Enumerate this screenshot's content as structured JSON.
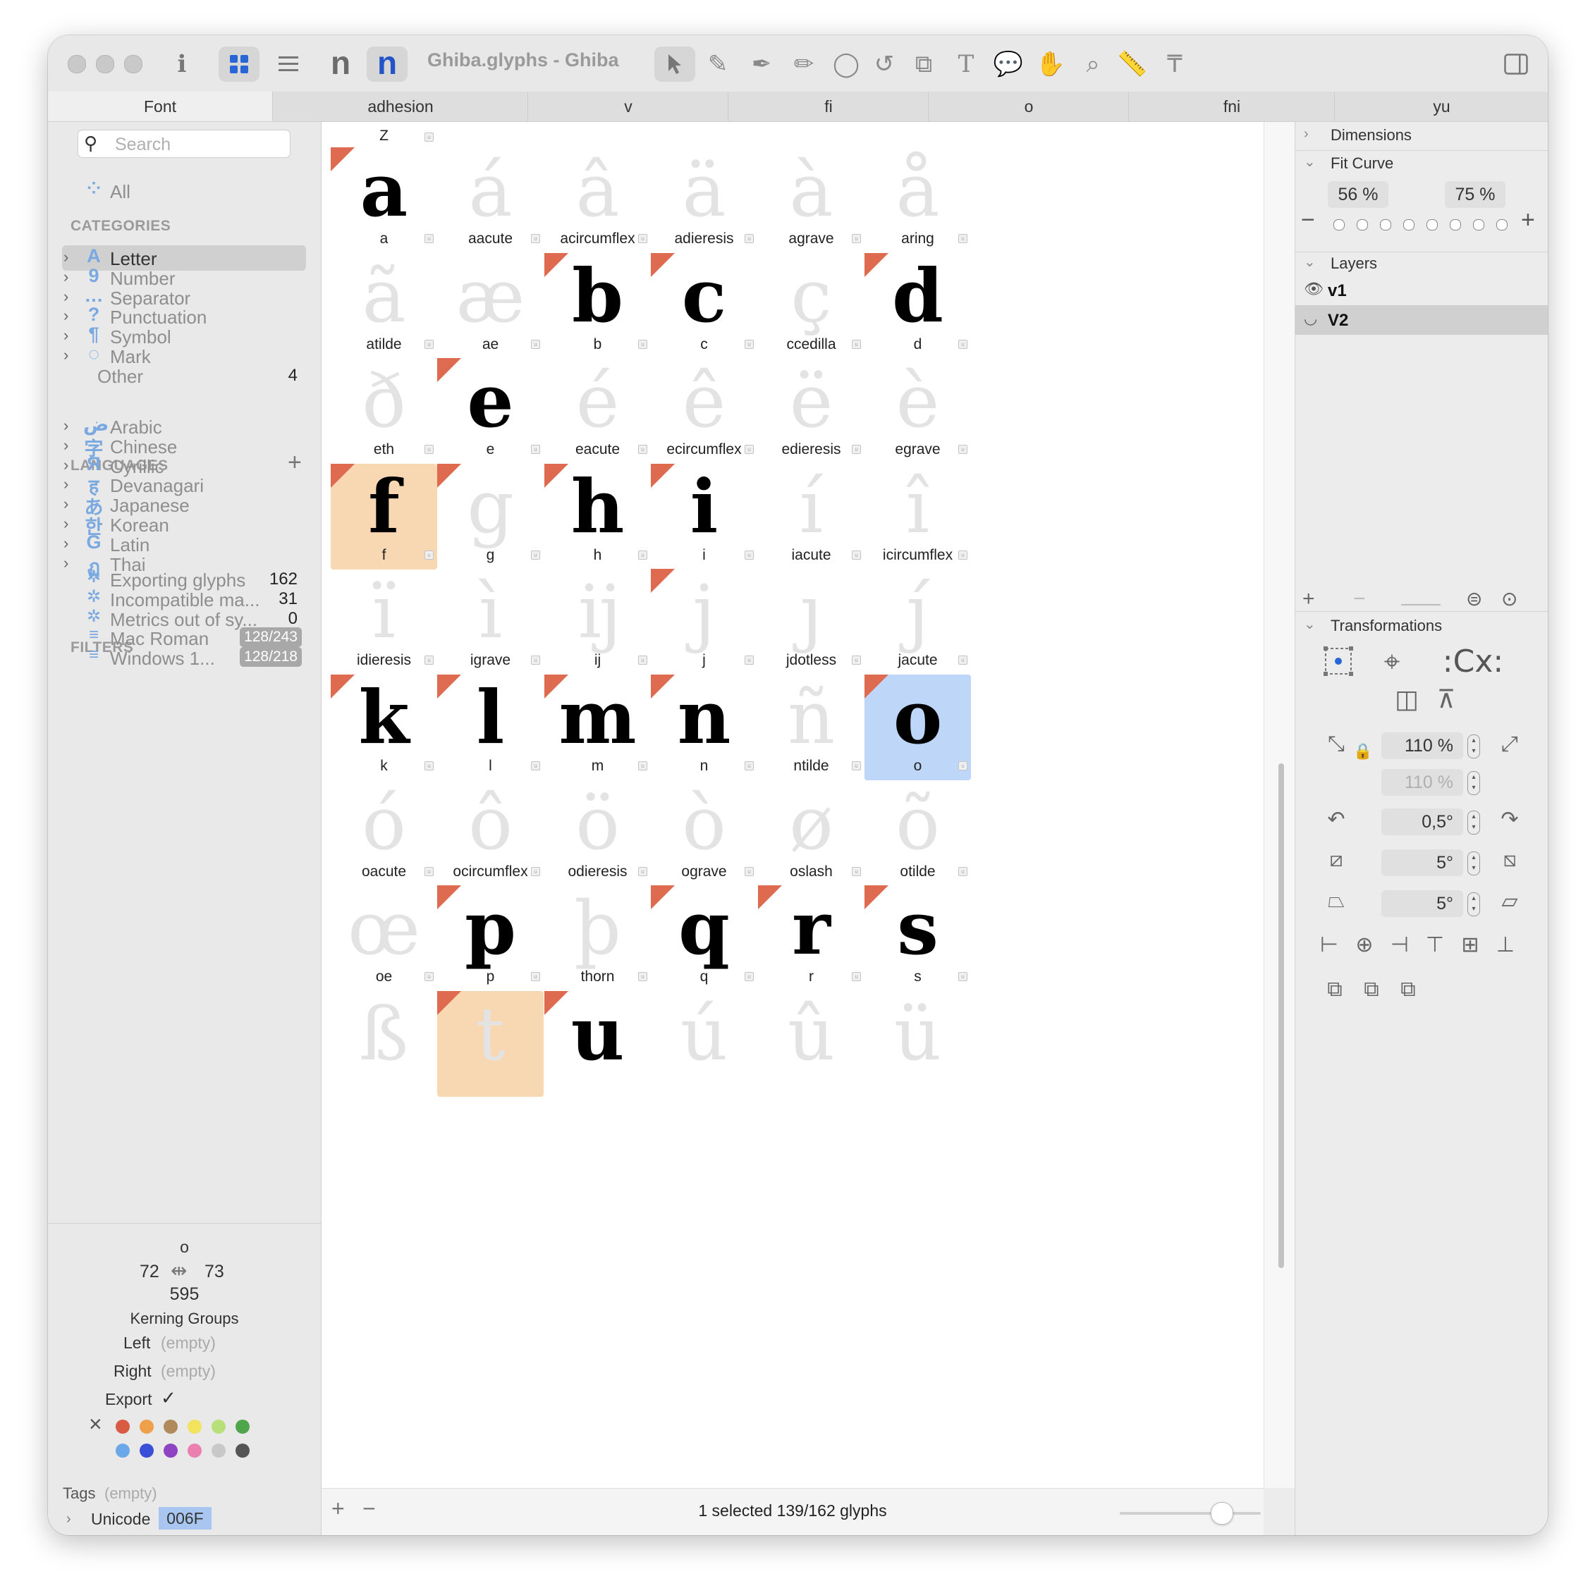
{
  "toolbar": {
    "doc_title": "Ghiba.glyphs - Ghiba",
    "info_icon": "info-icon",
    "view_grid_icon": "grid-view-icon",
    "view_list_icon": "list-view-icon"
  },
  "tabs": [
    "Font",
    "adhesion",
    "v",
    "fi",
    "o",
    "fni",
    "yu"
  ],
  "sidebar": {
    "search_placeholder": "Search",
    "all_label": "All",
    "categories_header": "CATEGORIES",
    "categories": [
      {
        "icon": "A",
        "label": "Letter",
        "count": ""
      },
      {
        "icon": "9",
        "label": "Number",
        "count": ""
      },
      {
        "icon": "…",
        "label": "Separator",
        "count": ""
      },
      {
        "icon": "?",
        "label": "Punctuation",
        "count": ""
      },
      {
        "icon": "¶",
        "label": "Symbol",
        "count": ""
      },
      {
        "icon": "◌",
        "label": "Mark",
        "count": ""
      },
      {
        "icon": "",
        "label": "Other",
        "count": "4"
      }
    ],
    "languages_header": "LANGUAGES",
    "languages": [
      {
        "icon": "ض",
        "label": "Arabic"
      },
      {
        "icon": "字",
        "label": "Chinese"
      },
      {
        "icon": "Я",
        "label": "Cyrillic"
      },
      {
        "icon": "ह",
        "label": "Devanagari"
      },
      {
        "icon": "あ",
        "label": "Japanese"
      },
      {
        "icon": "한",
        "label": "Korean"
      },
      {
        "icon": "G",
        "label": "Latin"
      },
      {
        "icon": "ฏ",
        "label": "Thai"
      }
    ],
    "filters_header": "FILTERS",
    "filters": [
      {
        "label": "Exporting glyphs",
        "count": "162",
        "badge": ""
      },
      {
        "label": "Incompatible ma...",
        "count": "31",
        "badge": ""
      },
      {
        "label": "Metrics out of sy...",
        "count": "0",
        "badge": ""
      },
      {
        "label": "Mac Roman",
        "count": "",
        "badge": "128/243"
      },
      {
        "label": "Windows 1...",
        "count": "",
        "badge": "128/218"
      }
    ],
    "info": {
      "glyph_name": "o",
      "lsb": "72",
      "rsb": "73",
      "width": "595",
      "kerning_groups_label": "Kerning Groups",
      "left_label": "Left",
      "left_value": "(empty)",
      "right_label": "Right",
      "right_value": "(empty)",
      "export_label": "Export",
      "export_check": "✓",
      "tags_label": "Tags",
      "tags_value": "(empty)",
      "unicode_label": "Unicode",
      "unicode_value": "006F"
    },
    "color_labels": [
      "#d95b43",
      "#f0a04b",
      "#b08a5a",
      "#f2e35c",
      "#b8e07a",
      "#4fa64a",
      "#6aa8e8",
      "#3a4fd8",
      "#8e44c2",
      "#ea7fb0",
      "#c8c8c8",
      "#555555"
    ]
  },
  "glyph_grid": {
    "top_row_partial": {
      "name": "Z"
    },
    "cells": [
      {
        "char": "a",
        "name": "a",
        "black": true,
        "flag": true,
        "sel": ""
      },
      {
        "char": "á",
        "name": "aacute",
        "black": false,
        "flag": false,
        "sel": ""
      },
      {
        "char": "â",
        "name": "acircumflex",
        "black": false,
        "flag": false,
        "sel": ""
      },
      {
        "char": "ä",
        "name": "adieresis",
        "black": false,
        "flag": false,
        "sel": ""
      },
      {
        "char": "à",
        "name": "agrave",
        "black": false,
        "flag": false,
        "sel": ""
      },
      {
        "char": "å",
        "name": "aring",
        "black": false,
        "flag": false,
        "sel": ""
      },
      {
        "char": "ã",
        "name": "atilde",
        "black": false,
        "flag": false,
        "sel": ""
      },
      {
        "char": "æ",
        "name": "ae",
        "black": false,
        "flag": false,
        "sel": ""
      },
      {
        "char": "b",
        "name": "b",
        "black": true,
        "flag": true,
        "sel": ""
      },
      {
        "char": "c",
        "name": "c",
        "black": true,
        "flag": true,
        "sel": ""
      },
      {
        "char": "ç",
        "name": "ccedilla",
        "black": false,
        "flag": false,
        "sel": ""
      },
      {
        "char": "d",
        "name": "d",
        "black": true,
        "flag": true,
        "sel": ""
      },
      {
        "char": "ð",
        "name": "eth",
        "black": false,
        "flag": false,
        "sel": ""
      },
      {
        "char": "e",
        "name": "e",
        "black": true,
        "flag": true,
        "sel": ""
      },
      {
        "char": "é",
        "name": "eacute",
        "black": false,
        "flag": false,
        "sel": ""
      },
      {
        "char": "ê",
        "name": "ecircumflex",
        "black": false,
        "flag": false,
        "sel": ""
      },
      {
        "char": "ë",
        "name": "edieresis",
        "black": false,
        "flag": false,
        "sel": ""
      },
      {
        "char": "è",
        "name": "egrave",
        "black": false,
        "flag": false,
        "sel": ""
      },
      {
        "char": "f",
        "name": "f",
        "black": true,
        "flag": true,
        "sel": "orange"
      },
      {
        "char": "g",
        "name": "g",
        "black": false,
        "flag": true,
        "sel": ""
      },
      {
        "char": "h",
        "name": "h",
        "black": true,
        "flag": true,
        "sel": ""
      },
      {
        "char": "i",
        "name": "i",
        "black": true,
        "flag": true,
        "sel": ""
      },
      {
        "char": "í",
        "name": "iacute",
        "black": false,
        "flag": false,
        "sel": ""
      },
      {
        "char": "î",
        "name": "icircumflex",
        "black": false,
        "flag": false,
        "sel": ""
      },
      {
        "char": "ï",
        "name": "idieresis",
        "black": false,
        "flag": false,
        "sel": ""
      },
      {
        "char": "ì",
        "name": "igrave",
        "black": false,
        "flag": false,
        "sel": ""
      },
      {
        "char": "ĳ",
        "name": "ij",
        "black": false,
        "flag": false,
        "sel": ""
      },
      {
        "char": "j",
        "name": "j",
        "black": false,
        "flag": true,
        "sel": ""
      },
      {
        "char": "ȷ",
        "name": "jdotless",
        "black": false,
        "flag": false,
        "sel": ""
      },
      {
        "char": "ȷ́",
        "name": "jacute",
        "black": false,
        "flag": false,
        "sel": ""
      },
      {
        "char": "k",
        "name": "k",
        "black": true,
        "flag": true,
        "sel": ""
      },
      {
        "char": "l",
        "name": "l",
        "black": true,
        "flag": true,
        "sel": ""
      },
      {
        "char": "m",
        "name": "m",
        "black": true,
        "flag": true,
        "sel": ""
      },
      {
        "char": "n",
        "name": "n",
        "black": true,
        "flag": true,
        "sel": ""
      },
      {
        "char": "ñ",
        "name": "ntilde",
        "black": false,
        "flag": false,
        "sel": ""
      },
      {
        "char": "o",
        "name": "o",
        "black": true,
        "flag": true,
        "sel": "blue"
      },
      {
        "char": "ó",
        "name": "oacute",
        "black": false,
        "flag": false,
        "sel": ""
      },
      {
        "char": "ô",
        "name": "ocircumflex",
        "black": false,
        "flag": false,
        "sel": ""
      },
      {
        "char": "ö",
        "name": "odieresis",
        "black": false,
        "flag": false,
        "sel": ""
      },
      {
        "char": "ò",
        "name": "ograve",
        "black": false,
        "flag": false,
        "sel": ""
      },
      {
        "char": "ø",
        "name": "oslash",
        "black": false,
        "flag": false,
        "sel": ""
      },
      {
        "char": "õ",
        "name": "otilde",
        "black": false,
        "flag": false,
        "sel": ""
      },
      {
        "char": "œ",
        "name": "oe",
        "black": false,
        "flag": false,
        "sel": ""
      },
      {
        "char": "p",
        "name": "p",
        "black": true,
        "flag": true,
        "sel": ""
      },
      {
        "char": "þ",
        "name": "thorn",
        "black": false,
        "flag": false,
        "sel": ""
      },
      {
        "char": "q",
        "name": "q",
        "black": true,
        "flag": true,
        "sel": ""
      },
      {
        "char": "r",
        "name": "r",
        "black": true,
        "flag": true,
        "sel": ""
      },
      {
        "char": "s",
        "name": "s",
        "black": true,
        "flag": true,
        "sel": ""
      },
      {
        "char": "ß",
        "name": "",
        "black": false,
        "flag": false,
        "sel": ""
      },
      {
        "char": "t",
        "name": "",
        "black": false,
        "flag": true,
        "sel": "orange"
      },
      {
        "char": "u",
        "name": "",
        "black": true,
        "flag": true,
        "sel": ""
      },
      {
        "char": "ú",
        "name": "",
        "black": false,
        "flag": false,
        "sel": ""
      },
      {
        "char": "û",
        "name": "",
        "black": false,
        "flag": false,
        "sel": ""
      },
      {
        "char": "ü",
        "name": "",
        "black": false,
        "flag": false,
        "sel": ""
      }
    ],
    "status": "1 selected 139/162 glyphs",
    "zoom_fraction": 0.72
  },
  "right_panel": {
    "dimensions_label": "Dimensions",
    "fit_curve_label": "Fit Curve",
    "fit_curve_min": "56 %",
    "fit_curve_max": "75 %",
    "layers_label": "Layers",
    "layers": [
      {
        "name": "v1",
        "icon": "eye-icon"
      },
      {
        "name": "V2",
        "icon": "eye-closed-icon"
      }
    ],
    "transformations_label": "Transformations",
    "scale_x": "110 %",
    "scale_y": "110 %",
    "rotate": "0,5°",
    "slant_h": "5°",
    "slant_v": "5°"
  }
}
